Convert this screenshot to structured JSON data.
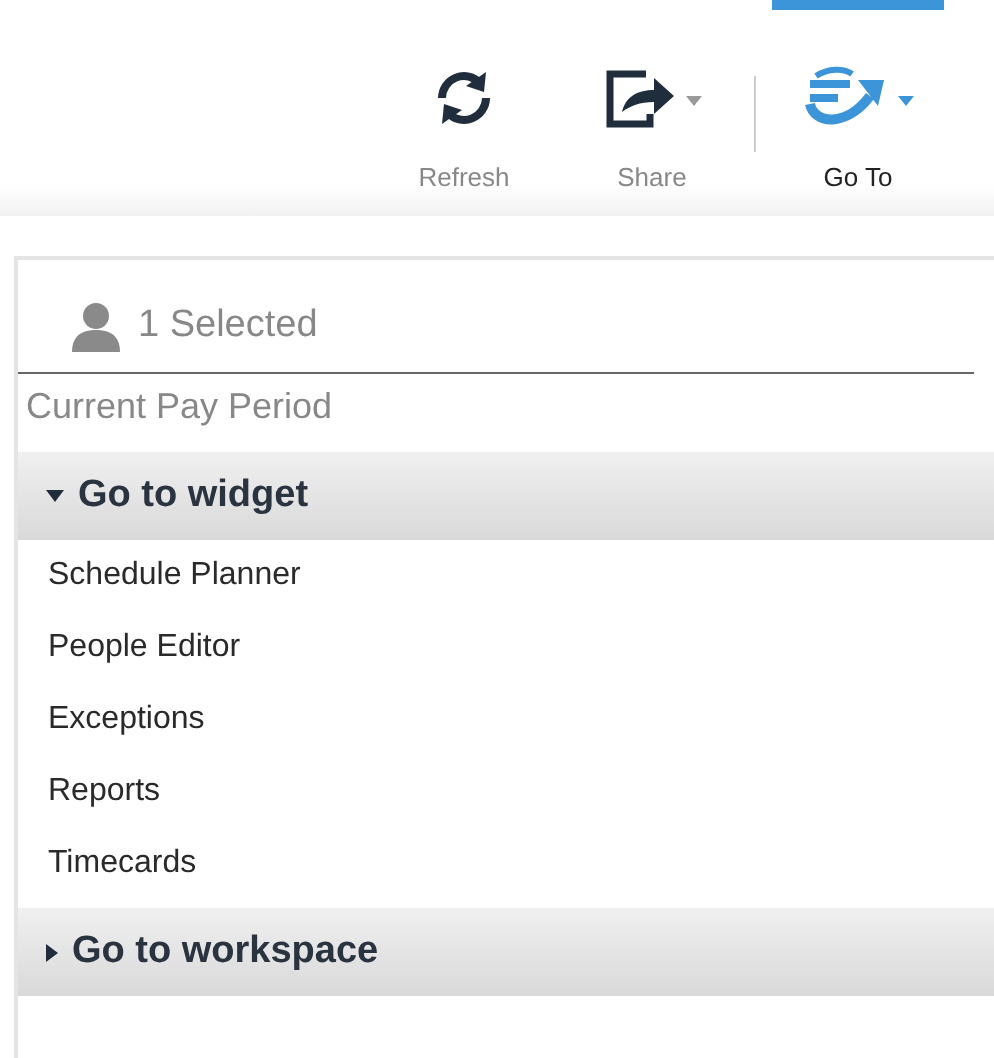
{
  "toolbar": [
    {
      "kind": "refresh",
      "label": "Refresh",
      "selected": false,
      "has_menu": false
    },
    {
      "kind": "share",
      "label": "Share",
      "selected": false,
      "has_menu": true
    },
    {
      "kind": "goto",
      "label": "Go To",
      "selected": true,
      "has_menu": true
    }
  ],
  "selection": {
    "label": "1 Selected"
  },
  "period": "Current Pay Period",
  "sections": [
    {
      "title": "Go to widget",
      "expanded": true,
      "items": [
        "Schedule Planner",
        "People Editor",
        "Exceptions",
        "Reports",
        "Timecards"
      ]
    },
    {
      "title": "Go to workspace",
      "expanded": false
    }
  ]
}
